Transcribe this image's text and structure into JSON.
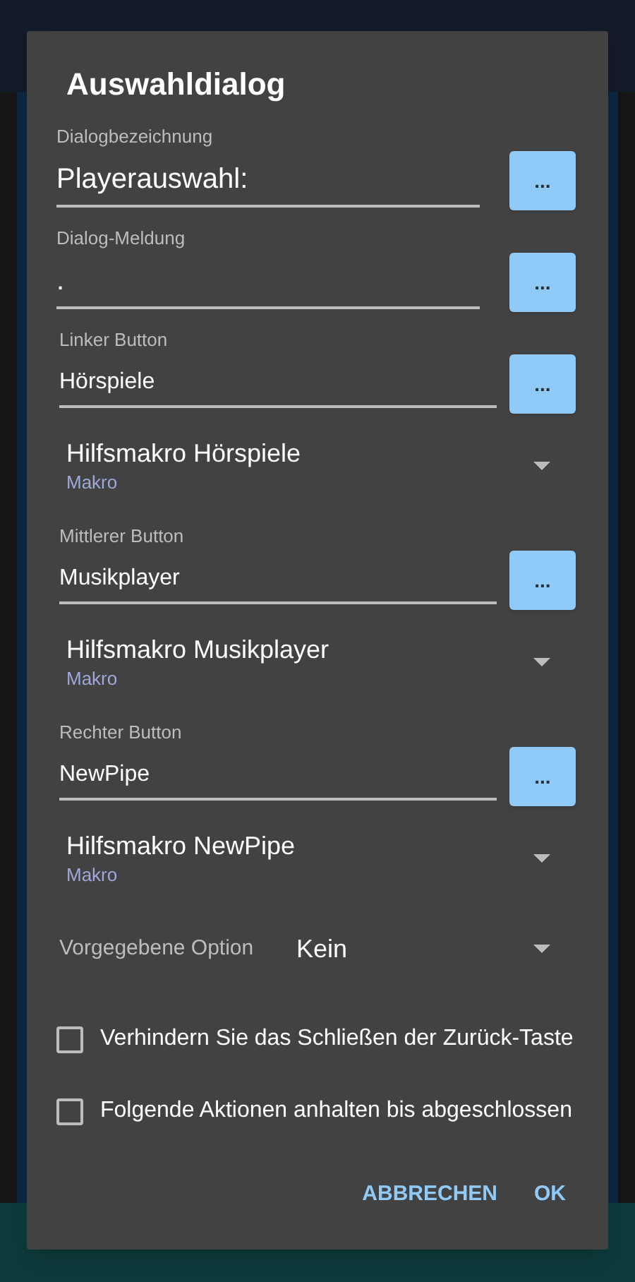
{
  "dialog": {
    "title": "Auswahldialog",
    "fields": [
      {
        "kind": "large",
        "label": "Dialogbezeichnung",
        "value": "Playerauswahl:",
        "button": "..."
      },
      {
        "kind": "large",
        "label": "Dialog-Meldung",
        "value": ".",
        "button": "..."
      },
      {
        "kind": "small",
        "label": "Linker Button",
        "value": "Hörspiele",
        "button": "...",
        "macro": {
          "title": "Hilfsmakro Hörspiele",
          "subtitle": "Makro"
        }
      },
      {
        "kind": "small",
        "label": "Mittlerer Button",
        "value": "Musikplayer",
        "button": "...",
        "macro": {
          "title": "Hilfsmakro Musikplayer",
          "subtitle": "Makro"
        }
      },
      {
        "kind": "small",
        "label": "Rechter Button",
        "value": "NewPipe",
        "button": "...",
        "macro": {
          "title": "Hilfsmakro NewPipe",
          "subtitle": "Makro"
        }
      }
    ],
    "default_option": {
      "label": "Vorgegebene Option",
      "value": "Kein"
    },
    "checkboxes": [
      {
        "label": "Verhindern Sie das Schließen der Zurück-Taste",
        "checked": false
      },
      {
        "label": "Folgende Aktionen anhalten bis abgeschlossen",
        "checked": false
      }
    ],
    "actions": [
      "ABBRECHEN",
      "OK"
    ]
  }
}
